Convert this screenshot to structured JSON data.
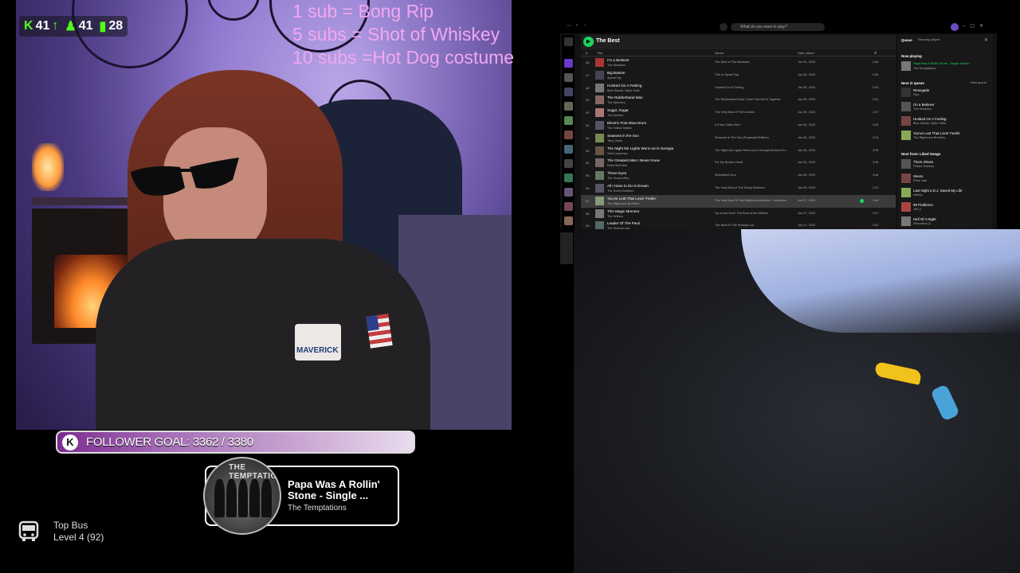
{
  "stream": {
    "stats": {
      "followers_count": "41",
      "viewers": "41",
      "chart_count": "28"
    },
    "sub_goals": [
      "1 sub      = Bong Rip",
      "5 subs   = Shot of Whiskey",
      "10 subs =Hot Dog costume"
    ],
    "shirt_patch": "MAVERICK",
    "follower_goal": {
      "icon_letter": "K",
      "label": "FOLLOWER GOAL: 3362 / 3380",
      "current": 3362,
      "target": 3380
    },
    "now_playing": {
      "album_text": "THE TEMPTATIONS",
      "title": "Papa Was A Rollin' Stone - Single ...",
      "artist": "The Temptations"
    },
    "top_bus": {
      "label": "Top Bus",
      "level": "Level 4  (92)"
    },
    "colors": {
      "kick_green": "#53fc18",
      "sub_text": "#f2a7f0",
      "spotify_green": "#1ed760"
    }
  },
  "spotify": {
    "search_placeholder": "What do you want to play?",
    "playlist_title": "The Best",
    "columns": {
      "num": "#",
      "title": "Title",
      "album": "Album",
      "date": "Date added",
      "duration": "⏱"
    },
    "tracks": [
      {
        "n": "46",
        "title": "I'm a Believer",
        "artist": "The Monkees",
        "album": "The Best of The Monkees",
        "date": "Jun 26, 2020",
        "dur": "2:50"
      },
      {
        "n": "47",
        "title": "Big Bottom",
        "artist": "Spinal Tap",
        "album": "This Is Spinal Tap",
        "date": "Jun 26, 2020",
        "dur": "3:35"
      },
      {
        "n": "48",
        "title": "Hooked On A Feeling",
        "artist": "Blue Swede, Björn Skifs",
        "album": "Hooked On A Feeling",
        "date": "Jun 26, 2020",
        "dur": "2:53"
      },
      {
        "n": "49",
        "title": "The Rubberband Man",
        "artist": "The Spinners",
        "album": "The Rubberband Man / Now That We're Together",
        "date": "Jun 26, 2020",
        "dur": "3:31"
      },
      {
        "n": "50",
        "title": "Sugar, Sugar",
        "artist": "The Archies",
        "album": "The Very Best Of The Archies",
        "date": "Jun 26, 2020",
        "dur": "2:47"
      },
      {
        "n": "51",
        "title": "Electric Pow Wow Drum",
        "artist": "The Halluci Nation",
        "album": "A Tribe Called Red",
        "date": "Jun 26, 2020",
        "dur": "3:43"
      },
      {
        "n": "52",
        "title": "Seasons in the Sun",
        "artist": "Terry Jacks",
        "album": "Seasons In The Sun (Expanded Edition)",
        "date": "Jun 26, 2020",
        "dur": "3:24"
      },
      {
        "n": "53",
        "title": "The Night the Lights Went out in Georgia",
        "artist": "Vicki Lawrence",
        "album": "The Night the Lights Went out in Georgia (Deluxe Ed...",
        "date": "Jun 26, 2020",
        "dur": "3:38"
      },
      {
        "n": "54",
        "title": "The Greatest Man I Never Knew",
        "artist": "Reba McEntire",
        "album": "For My Broken Heart",
        "date": "Jun 26, 2020",
        "dur": "3:36"
      },
      {
        "n": "55",
        "title": "These Eyes",
        "artist": "The Guess Who",
        "album": "Wheatfield Soul",
        "date": "Jun 26, 2020",
        "dur": "3:48"
      },
      {
        "n": "56",
        "title": "All I Have to Do Is Dream",
        "artist": "The Everly Brothers",
        "album": "The Very Best of The Everly Brothers",
        "date": "Jun 26, 2020",
        "dur": "2:21"
      },
      {
        "n": "57",
        "title": "You've Lost That Lovin' Feelin'",
        "artist": "The Righteous Brothers",
        "album": "The Very Best Of The Righteous Brothers - Unchaine...",
        "date": "Jun 27, 2020",
        "dur": "3:46"
      },
      {
        "n": "58",
        "title": "This Magic Moment",
        "artist": "The Drifters",
        "album": "Up on the Roof: The Best of the Drifters",
        "date": "Jun 27, 2020",
        "dur": "2:27"
      },
      {
        "n": "59",
        "title": "Leader Of The Pack",
        "artist": "The Shangri-Las",
        "album": "The Best Of The Shangri-Las",
        "date": "Jun 27, 2020",
        "dur": "2:51"
      }
    ],
    "queue": {
      "tab_queue": "Queue",
      "tab_recent": "Recently played",
      "now_playing_label": "Now playing",
      "now_playing_title": "Papa Was A Rollin' Stone - Single Version",
      "now_playing_artist": "The Temptations",
      "next_label": "Next in queue",
      "clear": "Clear queue",
      "next": [
        {
          "title": "Renegade",
          "artist": "Styx"
        },
        {
          "title": "I'm a Believer",
          "artist": "The Monkees"
        },
        {
          "title": "Hooked On A Feeling",
          "artist": "Blue Swede, Björn Skifs"
        },
        {
          "title": "You've Lost That Lovin' Feelin'",
          "artist": "The Righteous Brothers"
        }
      ],
      "liked_label": "Next from: Liked Songs",
      "liked": [
        {
          "title": "Thorn Shoes",
          "artist": "Patrick Sweany"
        },
        {
          "title": "Sirens",
          "artist": "Pearl Jam"
        },
        {
          "title": "Last Night a D.J. Saved My Life",
          "artist": "Indeep"
        },
        {
          "title": "99 Problems",
          "artist": "JAY-Z"
        },
        {
          "title": "Hell Of A Night",
          "artist": "Schoolboy Q"
        }
      ]
    }
  }
}
